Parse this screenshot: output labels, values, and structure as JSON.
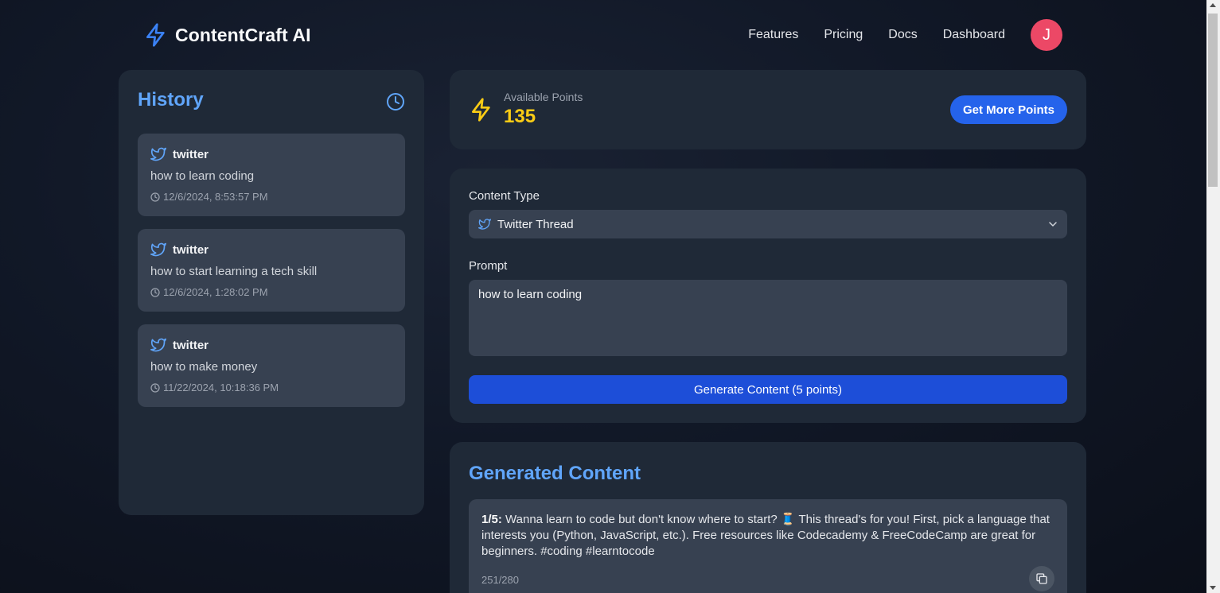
{
  "header": {
    "brand": "ContentCraft AI",
    "brand_icon": "lightning-bolt-icon",
    "nav": [
      "Features",
      "Pricing",
      "Docs",
      "Dashboard"
    ],
    "avatar_initial": "J",
    "avatar_color": "#ec4866"
  },
  "sidebar": {
    "title": "History",
    "title_icon": "clock-icon",
    "items": [
      {
        "platform": "twitter",
        "prompt": "how to learn coding",
        "time": "12/6/2024, 8:53:57 PM"
      },
      {
        "platform": "twitter",
        "prompt": "how to start learning a tech skill",
        "time": "12/6/2024, 1:28:02 PM"
      },
      {
        "platform": "twitter",
        "prompt": "how to make money",
        "time": "11/22/2024, 10:18:36 PM"
      }
    ]
  },
  "points": {
    "label": "Available Points",
    "value": "135",
    "button": "Get More Points"
  },
  "form": {
    "content_type_label": "Content Type",
    "content_type_value": "Twitter Thread",
    "prompt_label": "Prompt",
    "prompt_value": "how to learn coding",
    "generate_button": "Generate Content (5 points)"
  },
  "output": {
    "title": "Generated Content",
    "tweets": [
      {
        "number": "1/5:",
        "text": "Wanna learn to code but don't know where to start? 🧵 This thread's for you! First, pick a language that interests you (Python, JavaScript, etc.). Free resources like Codecademy & FreeCodeCamp are great for beginners. #coding #learntocode",
        "char_count": "251/280"
      }
    ]
  },
  "colors": {
    "accent": "#60a5fa",
    "button_blue": "#2563eb",
    "points_yellow": "#facc15",
    "card_bg": "#1f2937",
    "item_bg": "#374151"
  }
}
